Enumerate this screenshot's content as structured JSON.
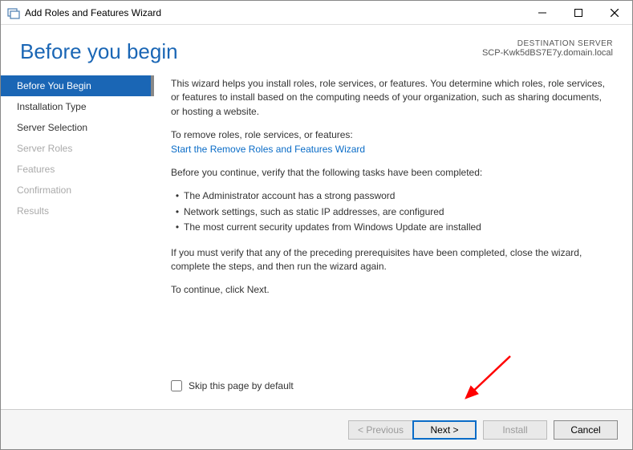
{
  "titlebar": {
    "title": "Add Roles and Features Wizard"
  },
  "header": {
    "page_title": "Before you begin",
    "destination_label": "DESTINATION SERVER",
    "destination_server": "SCP-Kwk5dBS7E7y.domain.local"
  },
  "sidebar": {
    "steps": [
      {
        "label": "Before You Begin",
        "state": "active"
      },
      {
        "label": "Installation Type",
        "state": "enabled"
      },
      {
        "label": "Server Selection",
        "state": "enabled"
      },
      {
        "label": "Server Roles",
        "state": "disabled"
      },
      {
        "label": "Features",
        "state": "disabled"
      },
      {
        "label": "Confirmation",
        "state": "disabled"
      },
      {
        "label": "Results",
        "state": "disabled"
      }
    ]
  },
  "content": {
    "intro": "This wizard helps you install roles, role services, or features. You determine which roles, role services, or features to install based on the computing needs of your organization, such as sharing documents, or hosting a website.",
    "remove_label": "To remove roles, role services, or features:",
    "remove_link": "Start the Remove Roles and Features Wizard",
    "verify_label": "Before you continue, verify that the following tasks have been completed:",
    "bullets": [
      "The Administrator account has a strong password",
      "Network settings, such as static IP addresses, are configured",
      "The most current security updates from Windows Update are installed"
    ],
    "verify_close": "If you must verify that any of the preceding prerequisites have been completed, close the wizard, complete the steps, and then run the wizard again.",
    "continue_label": "To continue, click Next.",
    "skip_label": "Skip this page by default"
  },
  "footer": {
    "previous": "< Previous",
    "next": "Next >",
    "install": "Install",
    "cancel": "Cancel"
  }
}
